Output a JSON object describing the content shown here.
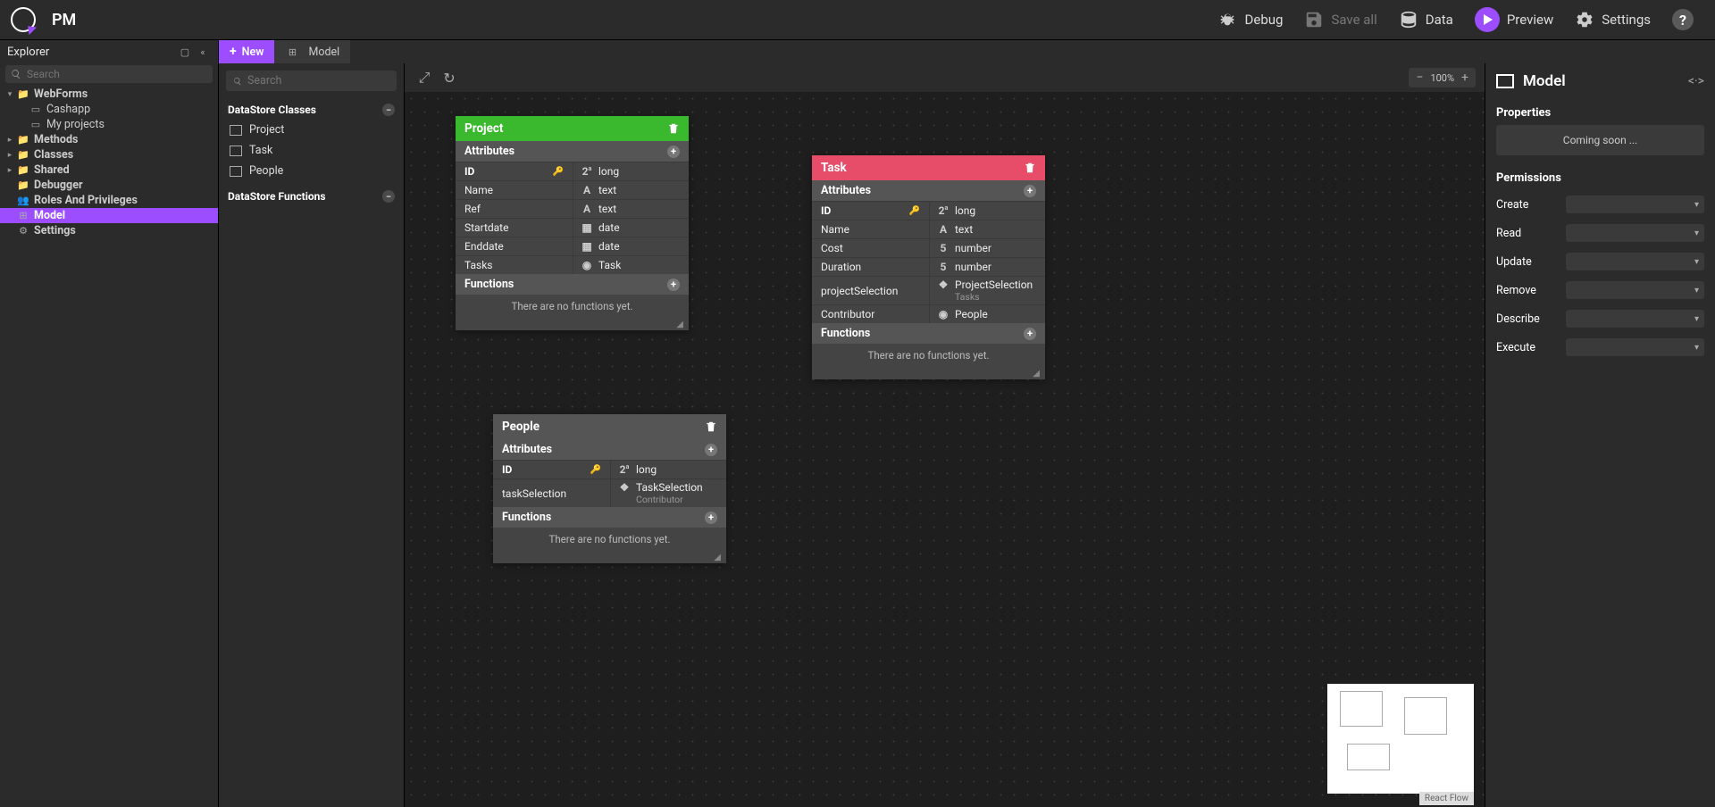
{
  "app_title": "PM",
  "header": {
    "debug": "Debug",
    "save_all": "Save all",
    "data": "Data",
    "preview": "Preview",
    "settings": "Settings"
  },
  "explorer": {
    "title": "Explorer",
    "search_placeholder": "Search",
    "tree": {
      "webforms": "WebForms",
      "cashapp": "Cashapp",
      "myprojects": "My projects",
      "methods": "Methods",
      "classes": "Classes",
      "shared": "Shared",
      "debugger": "Debugger",
      "roles": "Roles And Privileges",
      "model": "Model",
      "settings": "Settings"
    }
  },
  "tabs": {
    "new": "New",
    "model": "Model"
  },
  "ds_side": {
    "search_placeholder": "Search",
    "classes_h": "DataStore Classes",
    "classes": [
      "Project",
      "Task",
      "People"
    ],
    "functions_h": "DataStore Functions"
  },
  "canvas": {
    "zoom": "100%",
    "nodes": {
      "project": {
        "title": "Project",
        "attr_h": "Attributes",
        "func_h": "Functions",
        "no_func": "There are no functions yet.",
        "attrs": [
          {
            "name": "ID",
            "type": "long",
            "key": true,
            "icon": "2"
          },
          {
            "name": "Name",
            "type": "text",
            "icon": "A"
          },
          {
            "name": "Ref",
            "type": "text",
            "icon": "A"
          },
          {
            "name": "Startdate",
            "type": "date",
            "icon": "cal"
          },
          {
            "name": "Enddate",
            "type": "date",
            "icon": "cal"
          },
          {
            "name": "Tasks",
            "type": "Task",
            "icon": "rel"
          }
        ]
      },
      "task": {
        "title": "Task",
        "attr_h": "Attributes",
        "func_h": "Functions",
        "no_func": "There are no functions yet.",
        "attrs": [
          {
            "name": "ID",
            "type": "long",
            "key": true,
            "icon": "2"
          },
          {
            "name": "Name",
            "type": "text",
            "icon": "A"
          },
          {
            "name": "Cost",
            "type": "number",
            "icon": "5"
          },
          {
            "name": "Duration",
            "type": "number",
            "icon": "5"
          },
          {
            "name": "projectSelection",
            "type": "ProjectSelection",
            "sub": "Tasks",
            "icon": "relm"
          },
          {
            "name": "Contributor",
            "type": "People",
            "icon": "rel"
          }
        ]
      },
      "people": {
        "title": "People",
        "attr_h": "Attributes",
        "func_h": "Functions",
        "no_func": "There are no functions yet.",
        "attrs": [
          {
            "name": "ID",
            "type": "long",
            "key": true,
            "icon": "2"
          },
          {
            "name": "taskSelection",
            "type": "TaskSelection",
            "sub": "Contributor",
            "icon": "relm"
          }
        ]
      }
    },
    "react_flow": "React Flow"
  },
  "right": {
    "title": "Model",
    "properties_h": "Properties",
    "coming": "Coming soon ...",
    "permissions_h": "Permissions",
    "perms": [
      "Create",
      "Read",
      "Update",
      "Remove",
      "Describe",
      "Execute"
    ]
  }
}
